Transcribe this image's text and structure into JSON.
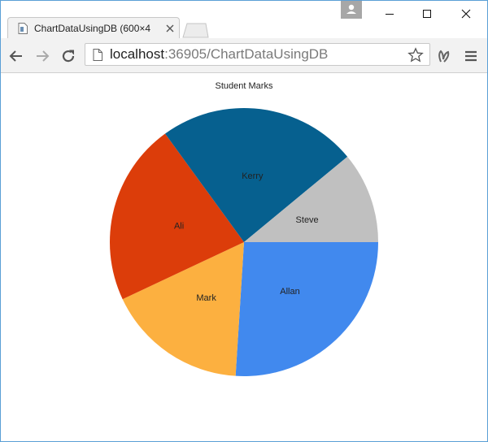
{
  "browser": {
    "tab_title": "ChartDataUsingDB (600×4",
    "url_host": "localhost",
    "url_path": ":36905/ChartDataUsingDB"
  },
  "icons": {
    "back": "arrow-left-icon",
    "forward": "arrow-right-icon",
    "reload": "reload-icon",
    "page": "page-icon",
    "bookmark": "star-icon",
    "extension": "extension-icon",
    "menu": "hamburger-menu-icon",
    "profile": "user-icon",
    "minimize": "minimize-icon",
    "maximize": "maximize-icon",
    "close": "close-icon"
  },
  "chart_data": {
    "type": "pie",
    "title": "Student Marks",
    "slices": [
      {
        "label": "Allan",
        "value": 26,
        "color": "#4189ee"
      },
      {
        "label": "Mark",
        "value": 17,
        "color": "#fcb040"
      },
      {
        "label": "Ali",
        "value": 22,
        "color": "#dc3d0a"
      },
      {
        "label": "Kerry",
        "value": 24,
        "color": "#06608f"
      },
      {
        "label": "Steve",
        "value": 11,
        "color": "#c0c0c0"
      }
    ],
    "start_angle_deg": 0,
    "direction": "clockwise",
    "legend": "none"
  }
}
